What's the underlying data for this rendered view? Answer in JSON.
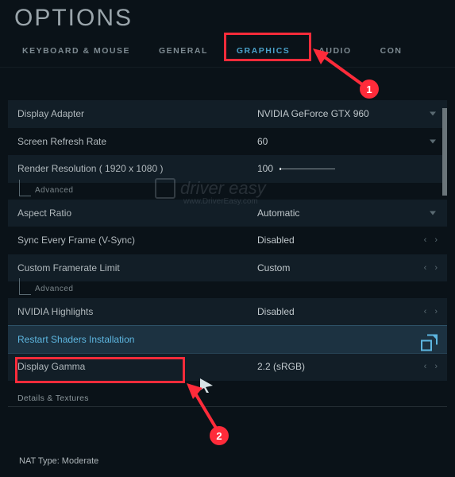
{
  "header": {
    "title": "OPTIONS"
  },
  "tabs": {
    "keyboard_mouse": "KEYBOARD & MOUSE",
    "general": "GENERAL",
    "graphics": "GRAPHICS",
    "audio": "AUDIO",
    "con": "CON"
  },
  "rows": {
    "display_adapter": {
      "label": "Display Adapter",
      "value": "NVIDIA GeForce GTX 960"
    },
    "screen_refresh": {
      "label": "Screen Refresh Rate",
      "value": "60"
    },
    "render_resolution": {
      "label": "Render Resolution ( 1920 x 1080 )",
      "value": "100"
    },
    "aspect_ratio": {
      "label": "Aspect Ratio",
      "value": "Automatic"
    },
    "vsync": {
      "label": "Sync Every Frame (V-Sync)",
      "value": "Disabled"
    },
    "framerate_limit": {
      "label": "Custom Framerate Limit",
      "value": "Custom"
    },
    "nvidia_highlights": {
      "label": "NVIDIA Highlights",
      "value": "Disabled"
    },
    "restart_shaders": {
      "label": "Restart Shaders Installation"
    },
    "display_gamma": {
      "label": "Display Gamma",
      "value": "2.2 (sRGB)"
    }
  },
  "advanced_label": "Advanced",
  "section_header": "Details & Textures",
  "footer": {
    "nat": "NAT Type: Moderate"
  },
  "watermark": {
    "main": "driver easy",
    "sub": "www.DriverEasy.com"
  },
  "annotations": {
    "badge1": "1",
    "badge2": "2"
  }
}
